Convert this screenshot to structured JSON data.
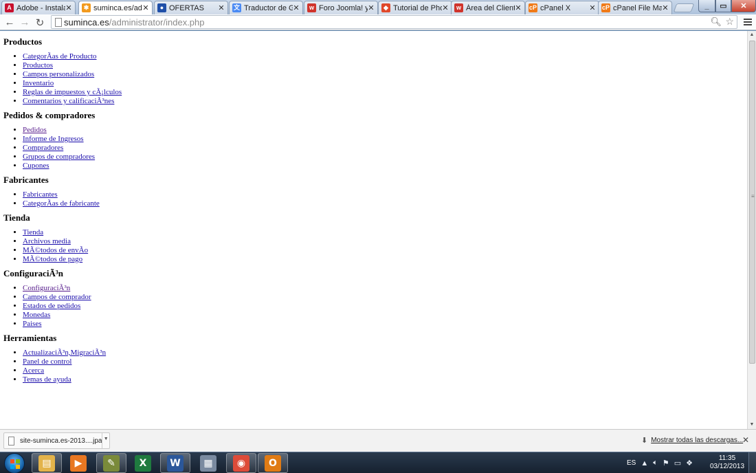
{
  "browser": {
    "tabs": [
      {
        "title": "Adobe - Instalac",
        "icon": "adobe-icon",
        "color": "#c8102e",
        "glyph": "A",
        "active": false
      },
      {
        "title": "suminca.es/adm",
        "icon": "joomla-icon",
        "color": "#f29a1e",
        "glyph": "✱",
        "active": true
      },
      {
        "title": "OFERTAS",
        "icon": "globe-icon",
        "color": "#1f4fa8",
        "glyph": "●",
        "active": false
      },
      {
        "title": "Traductor de Go",
        "icon": "translate-icon",
        "color": "#4a8af4",
        "glyph": "文",
        "active": false
      },
      {
        "title": "Foro Joomla! y V",
        "icon": "forum-icon",
        "color": "#d0342c",
        "glyph": "w",
        "active": false
      },
      {
        "title": "Tutorial de Phoc",
        "icon": "phoca-icon",
        "color": "#e0482a",
        "glyph": "◆",
        "active": false
      },
      {
        "title": "Área del Cliente",
        "icon": "client-area-icon",
        "color": "#d0342c",
        "glyph": "w",
        "active": false
      },
      {
        "title": "cPanel X",
        "icon": "cpanel-icon",
        "color": "#f07a18",
        "glyph": "cP",
        "active": false
      },
      {
        "title": "cPanel File Mana",
        "icon": "cpanel-icon",
        "color": "#f07a18",
        "glyph": "cP",
        "active": false
      }
    ],
    "url_host": "suminca.es",
    "url_path": "/administrator/index.php"
  },
  "page": {
    "sections": [
      {
        "heading": "Productos",
        "links": [
          {
            "label": "CategorÃ­as de Producto",
            "visited": false
          },
          {
            "label": "Productos",
            "visited": false
          },
          {
            "label": "Campos personalizados",
            "visited": false
          },
          {
            "label": "Inventario",
            "visited": false
          },
          {
            "label": "Reglas de impuestos y cÃ¡lculos",
            "visited": false
          },
          {
            "label": "Comentarios y calificaciÃ³nes",
            "visited": false
          }
        ]
      },
      {
        "heading": "Pedidos & compradores",
        "links": [
          {
            "label": "Pedidos",
            "visited": true
          },
          {
            "label": "Informe de Ingresos",
            "visited": false
          },
          {
            "label": "Compradores",
            "visited": false
          },
          {
            "label": "Grupos de compradores",
            "visited": false
          },
          {
            "label": "Cupones",
            "visited": false
          }
        ]
      },
      {
        "heading": "Fabricantes",
        "links": [
          {
            "label": "Fabricantes",
            "visited": false
          },
          {
            "label": "CategorÃ­as de fabricante",
            "visited": false
          }
        ]
      },
      {
        "heading": "Tienda",
        "links": [
          {
            "label": "Tienda",
            "visited": false
          },
          {
            "label": "Archivos media",
            "visited": false
          },
          {
            "label": "MÃ©todos de envÃ­o",
            "visited": false
          },
          {
            "label": "MÃ©todos de pago",
            "visited": false
          }
        ]
      },
      {
        "heading": "ConfiguraciÃ³n",
        "links": [
          {
            "label": "ConfiguraciÃ³n",
            "visited": true
          },
          {
            "label": "Campos de comprador",
            "visited": false
          },
          {
            "label": "Estados de pedidos",
            "visited": false
          },
          {
            "label": "Monedas",
            "visited": false
          },
          {
            "label": "Paises",
            "visited": false
          }
        ]
      },
      {
        "heading": "Herramientas",
        "links": [
          {
            "label": "ActualizaciÃ³n,MigraciÃ³n",
            "visited": false
          },
          {
            "label": "Panel de control",
            "visited": false
          },
          {
            "label": "Acerca",
            "visited": false
          },
          {
            "label": "Temas de ayuda",
            "visited": false
          }
        ]
      }
    ]
  },
  "downloads": {
    "file_name": "site-suminca.es-2013....jpa",
    "show_all": "Mostrar todas las descargas..."
  },
  "taskbar": {
    "apps": [
      {
        "name": "explorer-app-icon",
        "color": "#e3b34a",
        "glyph": "▤",
        "open": true
      },
      {
        "name": "media-player-app-icon",
        "color": "#e87722",
        "glyph": "▶",
        "open": false
      },
      {
        "name": "editor-app-icon",
        "color": "#7a8a3a",
        "glyph": "✎",
        "open": true
      },
      {
        "name": "excel-app-icon",
        "color": "#1f7a3f",
        "glyph": "X",
        "open": false
      },
      {
        "name": "word-app-icon",
        "color": "#2b579a",
        "glyph": "W",
        "open": true
      },
      {
        "name": "calculator-app-icon",
        "color": "#7a8aa0",
        "glyph": "▦",
        "open": false
      },
      {
        "name": "chrome-app-icon",
        "color": "#dd4b39",
        "glyph": "◉",
        "open": true
      },
      {
        "name": "outlook-app-icon",
        "color": "#e07b14",
        "glyph": "O",
        "open": true
      }
    ],
    "language": "ES",
    "time": "11:35",
    "date": "03/12/2013"
  }
}
